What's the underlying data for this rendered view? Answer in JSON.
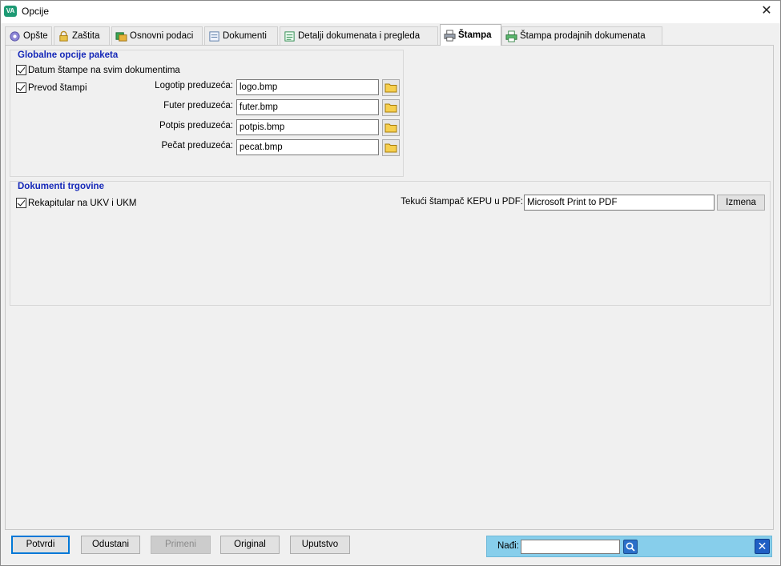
{
  "window": {
    "title": "Opcije",
    "app_icon_text": "VA"
  },
  "tabs": [
    {
      "label": "Opšte",
      "icon": "gear-icon"
    },
    {
      "label": "Zaštita",
      "icon": "lock-icon"
    },
    {
      "label": "Osnovni podaci",
      "icon": "folders-icon"
    },
    {
      "label": "Dokumenti",
      "icon": "document-icon"
    },
    {
      "label": "Detalji dokumenata i pregleda",
      "icon": "document-list-icon"
    },
    {
      "label": "Štampa",
      "icon": "printer-icon",
      "active": true
    },
    {
      "label": "Štampa prodajnih dokumenata",
      "icon": "printer-green-icon"
    }
  ],
  "global_group": {
    "title": "Globalne opcije paketa",
    "datum_label": "Datum štampe na svim dokumentima",
    "datum_checked": true,
    "prevod_label": "Prevod štampi",
    "prevod_checked": true,
    "fields": [
      {
        "label": "Logotip preduzeća:",
        "value": "logo.bmp"
      },
      {
        "label": "Futer preduzeća:",
        "value": "futer.bmp"
      },
      {
        "label": "Potpis preduzeća:",
        "value": "potpis.bmp"
      },
      {
        "label": "Pečat preduzeća:",
        "value": "pecat.bmp"
      }
    ]
  },
  "trade_group": {
    "title": "Dokumenti trgovine",
    "rekap_label": "Rekapitular na UKV i UKM",
    "rekap_checked": true,
    "printer_label": "Tekući štampač KEPU u PDF:",
    "printer_value": "Microsoft Print to PDF",
    "change_label": "Izmena"
  },
  "buttons": {
    "confirm": "Potvrdi",
    "cancel": "Odustani",
    "apply": "Primeni",
    "original": "Original",
    "help": "Uputstvo"
  },
  "find": {
    "label": "Nađi:",
    "value": ""
  },
  "colors": {
    "group_title": "#1528b8",
    "find_bar": "#87ceeb",
    "primary_border": "#0078d7"
  }
}
